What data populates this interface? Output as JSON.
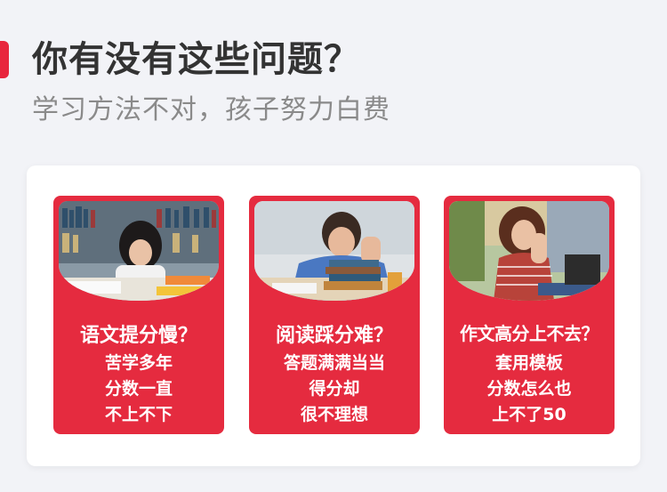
{
  "header": {
    "title": "你有没有这些问题？",
    "subtitle": "学习方法不对，孩子努力白费"
  },
  "colors": {
    "accent": "#e8263d",
    "card_bg": "#e52b3f",
    "title_text": "#333333",
    "subtitle_text": "#8a8a8a",
    "page_bg": "#f2f3f7"
  },
  "cards": [
    {
      "title": "语文提分慢？",
      "lines": [
        "苦学多年",
        "分数一直",
        "不上不下"
      ],
      "image": "student-with-books-in-library-photo"
    },
    {
      "title": "阅读踩分难？",
      "lines": [
        "答题满满当当",
        "得分却",
        "很不理想"
      ],
      "image": "boy-studying-with-book-stack-photo"
    },
    {
      "title": "作文高分上不去？",
      "lines": [
        "套用模板",
        "分数怎么也",
        "上不了50"
      ],
      "image": "girl-thinking-at-desk-photo"
    }
  ]
}
